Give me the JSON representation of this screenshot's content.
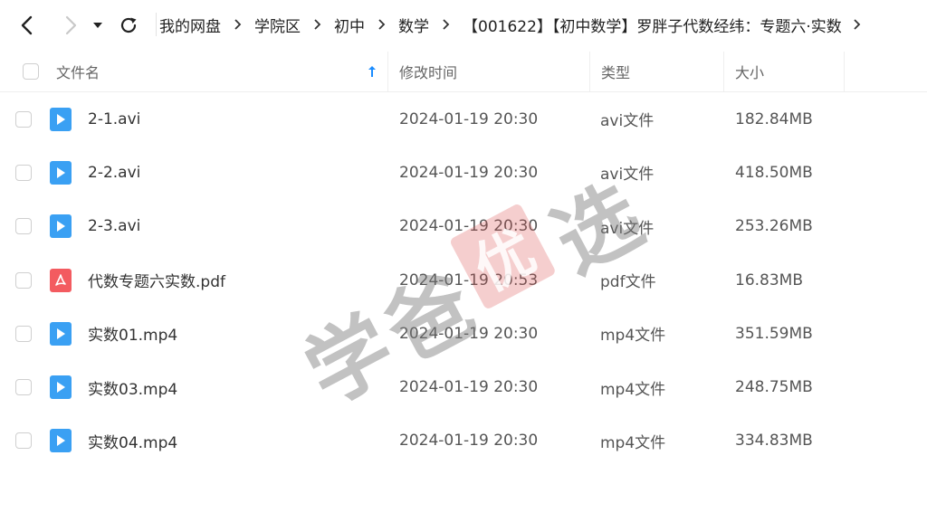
{
  "toolbar": {
    "back_icon": "chevron-left-icon",
    "forward_icon": "chevron-right-icon",
    "history_icon": "caret-down-icon",
    "refresh_icon": "refresh-icon"
  },
  "breadcrumb": {
    "items": [
      "我的网盘",
      "学院区",
      "初中",
      "数学",
      "【001622】【初中数学】罗胖子代数经纬：专题六·实数"
    ],
    "more_icon": "chevron-right-icon"
  },
  "header": {
    "name": "文件名",
    "modified": "修改时间",
    "type": "类型",
    "size": "大小",
    "sort_icon": "sort-ascending-arrow-icon",
    "sort_color": "#1a8cff"
  },
  "files": [
    {
      "name": "2-1.avi",
      "modified": "2024-01-19 20:30",
      "type": "avi文件",
      "size": "182.84MB",
      "icon": "video-file-icon"
    },
    {
      "name": "2-2.avi",
      "modified": "2024-01-19 20:30",
      "type": "avi文件",
      "size": "418.50MB",
      "icon": "video-file-icon"
    },
    {
      "name": "2-3.avi",
      "modified": "2024-01-19 20:30",
      "type": "avi文件",
      "size": "253.26MB",
      "icon": "video-file-icon"
    },
    {
      "name": "代数专题六实数.pdf",
      "modified": "2024-01-19 20:53",
      "type": "pdf文件",
      "size": "16.83MB",
      "icon": "pdf-file-icon"
    },
    {
      "name": "实数01.mp4",
      "modified": "2024-01-19 20:30",
      "type": "mp4文件",
      "size": "351.59MB",
      "icon": "video-file-icon"
    },
    {
      "name": "实数03.mp4",
      "modified": "2024-01-19 20:30",
      "type": "mp4文件",
      "size": "248.75MB",
      "icon": "video-file-icon"
    },
    {
      "name": "实数04.mp4",
      "modified": "2024-01-19 20:30",
      "type": "mp4文件",
      "size": "334.83MB",
      "icon": "video-file-icon"
    }
  ],
  "watermark": {
    "chars": [
      "学",
      "爸",
      "优",
      "选"
    ]
  },
  "colors": {
    "video_icon": "#3aa0f3",
    "pdf_icon": "#f35b60",
    "accent": "#1a8cff"
  }
}
